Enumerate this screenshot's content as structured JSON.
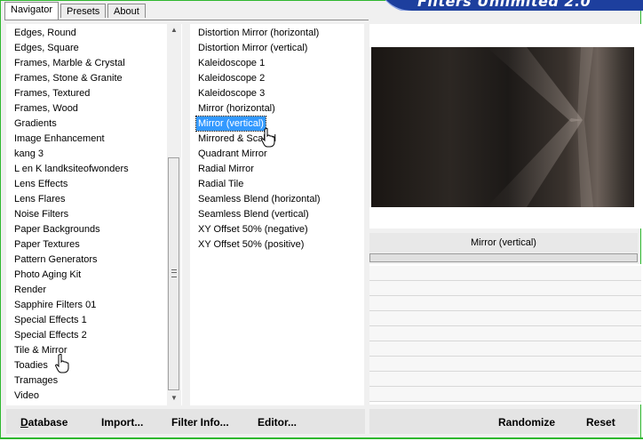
{
  "tabs": [
    {
      "label": "Navigator"
    },
    {
      "label": "Presets"
    },
    {
      "label": "About"
    }
  ],
  "banner": {
    "text": "Filters Unlimited 2.0"
  },
  "categories": [
    "Edges, Round",
    "Edges, Square",
    "Frames, Marble & Crystal",
    "Frames, Stone & Granite",
    "Frames, Textured",
    "Frames, Wood",
    "Gradients",
    "Image Enhancement",
    "kang 3",
    "L en K landksiteofwonders",
    "Lens Effects",
    "Lens Flares",
    "Noise Filters",
    "Paper Backgrounds",
    "Paper Textures",
    "Pattern Generators",
    "Photo Aging Kit",
    "Render",
    "Sapphire Filters 01",
    "Special Effects 1",
    "Special Effects 2",
    "Tile & Mirror",
    "Toadies",
    "Tramages",
    "Video"
  ],
  "filters": [
    "Distortion Mirror (horizontal)",
    "Distortion Mirror (vertical)",
    "Kaleidoscope 1",
    "Kaleidoscope 2",
    "Kaleidoscope 3",
    "Mirror (horizontal)",
    "Mirror (vertical)",
    "Mirrored & Scaled",
    "Quadrant Mirror",
    "Radial Mirror",
    "Radial Tile",
    "Seamless Blend (horizontal)",
    "Seamless Blend (vertical)",
    "XY Offset 50% (negative)",
    "XY Offset 50% (positive)"
  ],
  "selected_filter": "Mirror (vertical)",
  "buttons": {
    "database": "Database",
    "import": "Import...",
    "filter_info": "Filter Info...",
    "editor": "Editor...",
    "randomize": "Randomize",
    "reset": "Reset"
  },
  "colors": {
    "frame": "#2fb82f",
    "selection": "#3399ff",
    "banner": "#1d3f9e"
  }
}
